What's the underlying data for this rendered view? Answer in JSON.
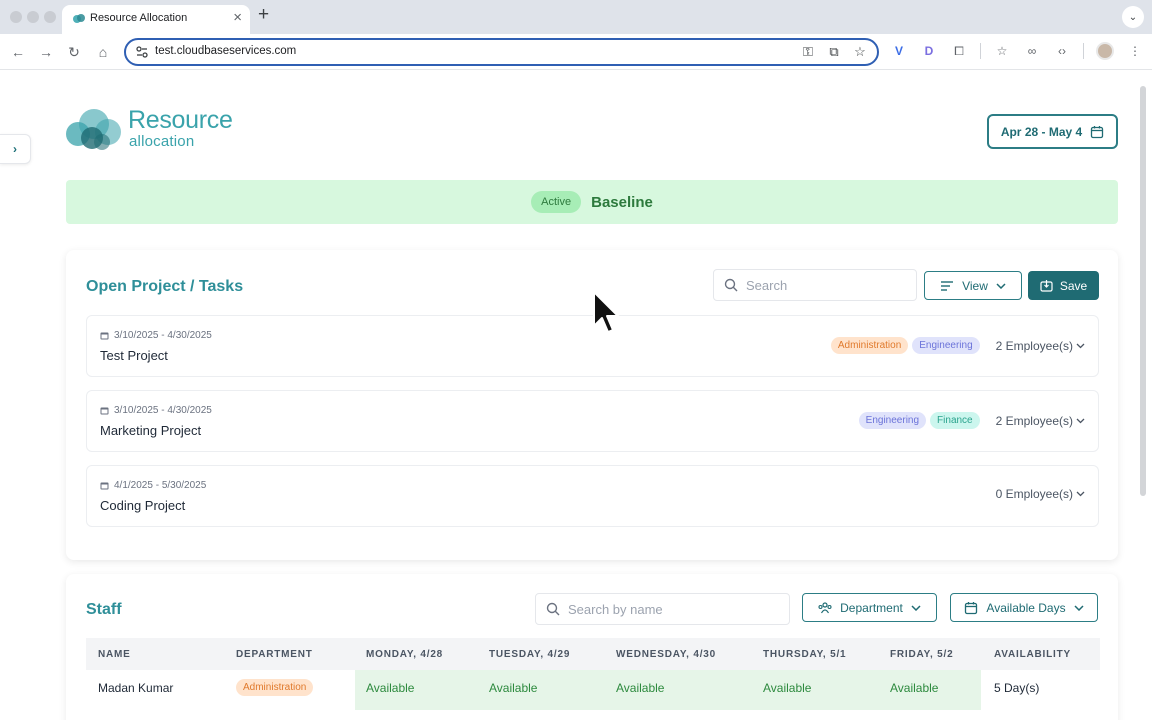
{
  "browser": {
    "tab_title": "Resource Allocation",
    "url": "test.cloudbaseservices.com"
  },
  "logo": {
    "main": "Resource",
    "sub": "allocation"
  },
  "header": {
    "date_range": "Apr 28 - May 4"
  },
  "baseline": {
    "status": "Active",
    "name": "Baseline"
  },
  "projects": {
    "title": "Open Project / Tasks",
    "search_placeholder": "Search",
    "view_label": "View",
    "save_label": "Save",
    "items": [
      {
        "dates": "3/10/2025 - 4/30/2025",
        "name": "Test Project",
        "tags": [
          "Administration",
          "Engineering"
        ],
        "employees": "2 Employee(s)"
      },
      {
        "dates": "3/10/2025 - 4/30/2025",
        "name": "Marketing Project",
        "tags": [
          "Engineering",
          "Finance"
        ],
        "employees": "2 Employee(s)"
      },
      {
        "dates": "4/1/2025 - 5/30/2025",
        "name": "Coding Project",
        "tags": [],
        "employees": "0 Employee(s)"
      }
    ]
  },
  "staff": {
    "title": "Staff",
    "search_placeholder": "Search by name",
    "department_label": "Department",
    "available_days_label": "Available Days",
    "columns": [
      "NAME",
      "DEPARTMENT",
      "MONDAY, 4/28",
      "TUESDAY, 4/29",
      "WEDNESDAY, 4/30",
      "THURSDAY, 5/1",
      "FRIDAY, 5/2",
      "AVAILABILITY"
    ],
    "rows": [
      {
        "name": "Madan Kumar",
        "department": "Administration",
        "days": [
          "Available",
          "Available",
          "Available",
          "Available",
          "Available"
        ],
        "availability": "5 Day(s)"
      }
    ]
  },
  "colors": {
    "accent": "#2f8f99",
    "primary": "#1f6b73",
    "baseline_bg": "#d7f8de",
    "available": "#2d8a3e"
  }
}
